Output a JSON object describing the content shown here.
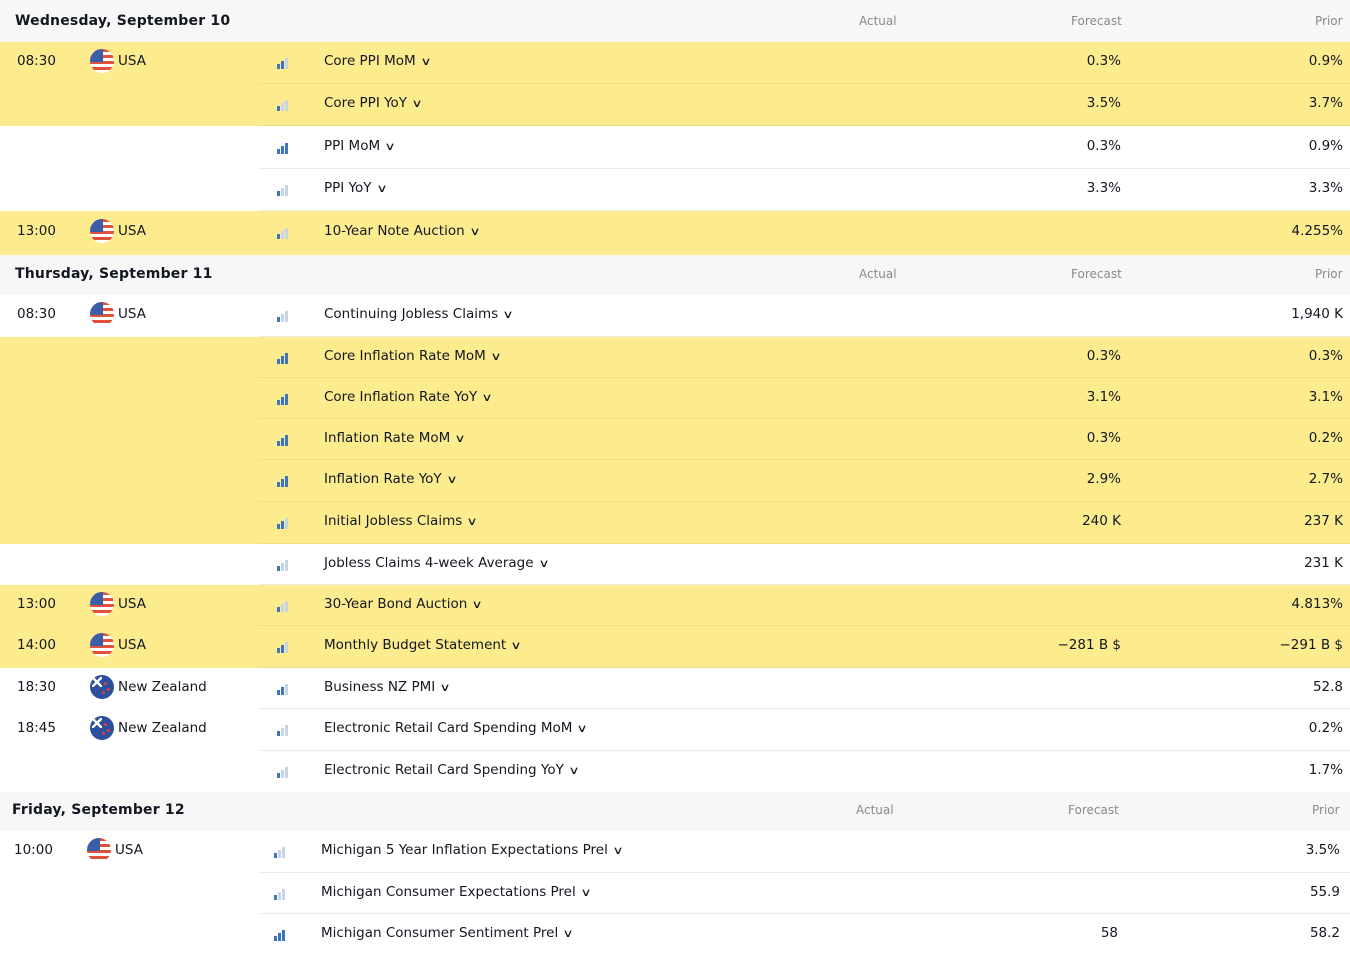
{
  "columns": {
    "actual": "Actual",
    "forecast": "Forecast",
    "prior": "Prior"
  },
  "sections": [
    {
      "date": "Wednesday, September 10",
      "rows": [
        {
          "time": "08:30",
          "country": "USA",
          "flag": "usa-flag-icon",
          "importance": 2,
          "event": "Core PPI MoM",
          "actual": "",
          "forecast": "0.3%",
          "prior": "0.9%",
          "highlight": true
        },
        {
          "time": "",
          "country": "",
          "flag": "",
          "importance": 1,
          "event": "Core PPI YoY",
          "actual": "",
          "forecast": "3.5%",
          "prior": "3.7%",
          "highlight": true
        },
        {
          "time": "",
          "country": "",
          "flag": "",
          "importance": 3,
          "event": "PPI MoM",
          "actual": "",
          "forecast": "0.3%",
          "prior": "0.9%",
          "highlight": false
        },
        {
          "time": "",
          "country": "",
          "flag": "",
          "importance": 1,
          "event": "PPI YoY",
          "actual": "",
          "forecast": "3.3%",
          "prior": "3.3%",
          "highlight": false
        },
        {
          "time": "13:00",
          "country": "USA",
          "flag": "usa-flag-icon",
          "importance": 1,
          "event": "10-Year Note Auction",
          "actual": "",
          "forecast": "",
          "prior": "4.255%",
          "highlight": true
        }
      ]
    },
    {
      "date": "Thursday, September 11",
      "rows": [
        {
          "time": "08:30",
          "country": "USA",
          "flag": "usa-flag-icon",
          "importance": 1,
          "event": "Continuing Jobless Claims",
          "actual": "",
          "forecast": "",
          "prior": "1,940 K",
          "highlight": false
        },
        {
          "time": "",
          "country": "",
          "flag": "",
          "importance": 3,
          "event": "Core Inflation Rate MoM",
          "actual": "",
          "forecast": "0.3%",
          "prior": "0.3%",
          "highlight": true
        },
        {
          "time": "",
          "country": "",
          "flag": "",
          "importance": 3,
          "event": "Core Inflation Rate YoY",
          "actual": "",
          "forecast": "3.1%",
          "prior": "3.1%",
          "highlight": true
        },
        {
          "time": "",
          "country": "",
          "flag": "",
          "importance": 3,
          "event": "Inflation Rate MoM",
          "actual": "",
          "forecast": "0.3%",
          "prior": "0.2%",
          "highlight": true
        },
        {
          "time": "",
          "country": "",
          "flag": "",
          "importance": 3,
          "event": "Inflation Rate YoY",
          "actual": "",
          "forecast": "2.9%",
          "prior": "2.7%",
          "highlight": true
        },
        {
          "time": "",
          "country": "",
          "flag": "",
          "importance": 2,
          "event": "Initial Jobless Claims",
          "actual": "",
          "forecast": "240 K",
          "prior": "237 K",
          "highlight": true
        },
        {
          "time": "",
          "country": "",
          "flag": "",
          "importance": 1,
          "event": "Jobless Claims 4-week Average",
          "actual": "",
          "forecast": "",
          "prior": "231 K",
          "highlight": false
        },
        {
          "time": "13:00",
          "country": "USA",
          "flag": "usa-flag-icon",
          "importance": 1,
          "event": "30-Year Bond Auction",
          "actual": "",
          "forecast": "",
          "prior": "4.813%",
          "highlight": true
        },
        {
          "time": "14:00",
          "country": "USA",
          "flag": "usa-flag-icon",
          "importance": 2,
          "event": "Monthly Budget Statement",
          "actual": "",
          "forecast": "−281 B $",
          "prior": "−291 B $",
          "highlight": true
        },
        {
          "time": "18:30",
          "country": "New Zealand",
          "flag": "new-zealand-flag-icon",
          "importance": 2,
          "event": "Business NZ PMI",
          "actual": "",
          "forecast": "",
          "prior": "52.8",
          "highlight": false
        },
        {
          "time": "18:45",
          "country": "New Zealand",
          "flag": "new-zealand-flag-icon",
          "importance": 1,
          "event": "Electronic Retail Card Spending MoM",
          "actual": "",
          "forecast": "",
          "prior": "0.2%",
          "highlight": false
        },
        {
          "time": "",
          "country": "",
          "flag": "",
          "importance": 1,
          "event": "Electronic Retail Card Spending YoY",
          "actual": "",
          "forecast": "",
          "prior": "1.7%",
          "highlight": false
        }
      ]
    },
    {
      "date": "Friday, September 12",
      "rows": [
        {
          "time": "10:00",
          "country": "USA",
          "flag": "usa-flag-icon",
          "importance": 1,
          "event": "Michigan 5 Year Inflation Expectations Prel",
          "actual": "",
          "forecast": "",
          "prior": "3.5%",
          "highlight": false
        },
        {
          "time": "",
          "country": "",
          "flag": "",
          "importance": 1,
          "event": "Michigan Consumer Expectations Prel",
          "actual": "",
          "forecast": "",
          "prior": "55.9",
          "highlight": false
        },
        {
          "time": "",
          "country": "",
          "flag": "",
          "importance": 3,
          "event": "Michigan Consumer Sentiment Prel",
          "actual": "",
          "forecast": "58",
          "prior": "58.2",
          "highlight": false
        }
      ]
    }
  ]
}
